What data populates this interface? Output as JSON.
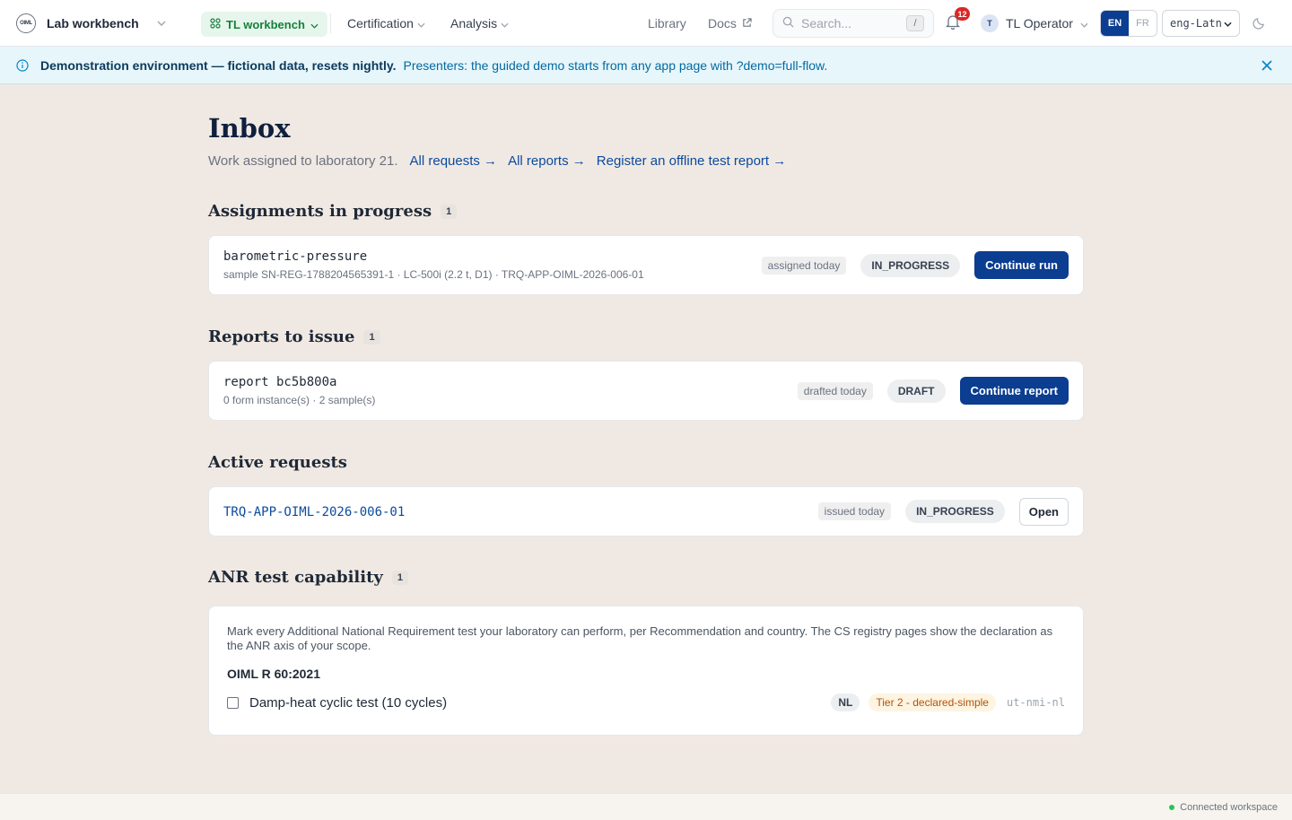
{
  "header": {
    "app_name": "Lab workbench",
    "workbench_label": "TL workbench",
    "nav": [
      {
        "label": "Certification"
      },
      {
        "label": "Analysis"
      }
    ],
    "library_label": "Library",
    "docs_label": "Docs",
    "search_placeholder": "Search...",
    "search_shortcut": "/",
    "notification_count": "12",
    "user_initial": "T",
    "user_name": "TL Operator",
    "lang_en": "EN",
    "lang_fr": "FR",
    "script_value": "eng-Latn",
    "logo_text": "OIML"
  },
  "banner": {
    "title": "Demonstration environment — fictional data, resets nightly.",
    "message": "Presenters: the guided demo starts from any app page with ?demo=full-flow."
  },
  "page": {
    "title": "Inbox",
    "subtitle": "Work assigned to laboratory 21.",
    "links": [
      "All requests →",
      "All reports →",
      "Register an offline test report →"
    ]
  },
  "assignments": {
    "heading": "Assignments in progress",
    "count": "1",
    "items": [
      {
        "title": "barometric-pressure",
        "meta": "sample SN-REG-1788204565391-1 · LC-500i (2.2 t, D1) · TRQ-APP-OIML-2026-006-01",
        "age": "assigned today",
        "status": "IN_PROGRESS",
        "action": "Continue run"
      }
    ]
  },
  "reports": {
    "heading": "Reports to issue",
    "count": "1",
    "items": [
      {
        "title": "report bc5b800a",
        "meta": "0 form instance(s) · 2 sample(s)",
        "age": "drafted today",
        "status": "DRAFT",
        "action": "Continue report"
      }
    ]
  },
  "requests": {
    "heading": "Active requests",
    "items": [
      {
        "title": "TRQ-APP-OIML-2026-006-01",
        "age": "issued today",
        "status": "IN_PROGRESS",
        "action": "Open"
      }
    ]
  },
  "anr": {
    "heading": "ANR test capability",
    "count": "1",
    "description": "Mark every Additional National Requirement test your laboratory can perform, per Recommendation and country. The CS registry pages show the declaration as the ANR axis of your scope.",
    "recommendation": "OIML R 60:2021",
    "tests": [
      {
        "label": "Damp-heat cyclic test (10 cycles)",
        "checked": false,
        "country": "NL",
        "tier": "Tier 2 - declared-simple",
        "code": "ut-nmi-nl"
      }
    ]
  },
  "footer": {
    "status": "Connected workspace"
  },
  "colors": {
    "primary": "#0b3d91",
    "page_bg": "#f0e9e3",
    "banner_bg": "#e6f6fb",
    "workbench_green": "#15803d",
    "tier_amber": "#b45309",
    "badge_red": "#dc2626"
  }
}
